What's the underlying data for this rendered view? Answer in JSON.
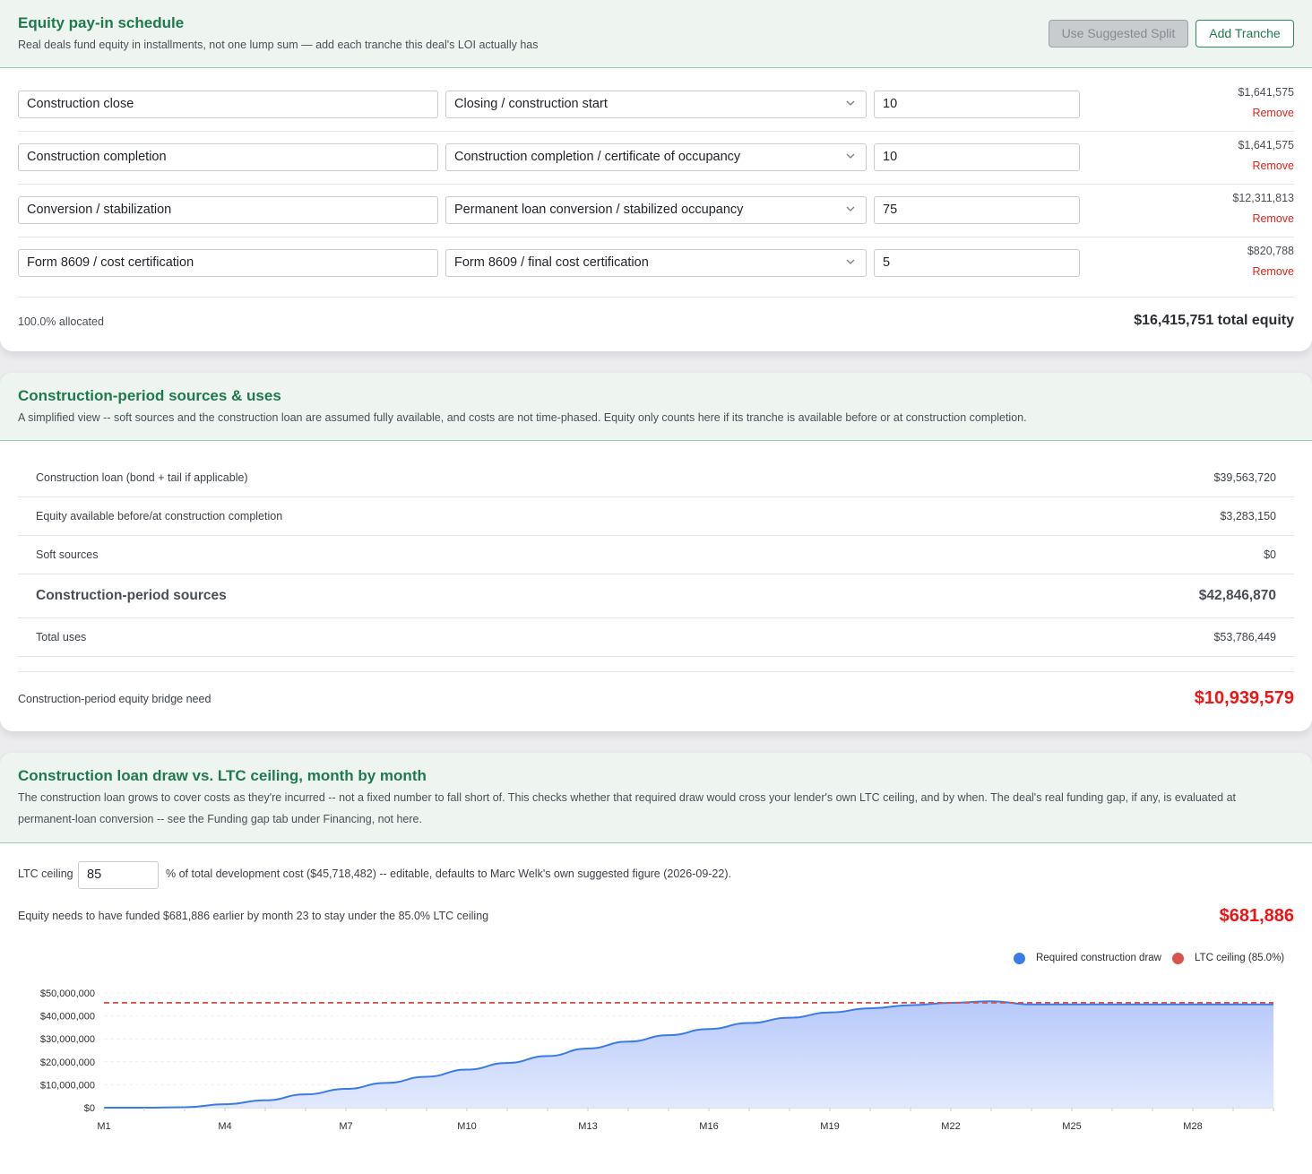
{
  "equity_schedule": {
    "title": "Equity pay-in schedule",
    "subtitle": "Real deals fund equity in installments, not one lump sum — add each tranche this deal's LOI actually has",
    "use_suggested_split_label": "Use Suggested Split",
    "add_tranche_label": "Add Tranche",
    "remove_label": "Remove",
    "tranches": [
      {
        "name": "Construction close",
        "milestone": "Closing / construction start",
        "percent": "10",
        "amount": "$1,641,575"
      },
      {
        "name": "Construction completion",
        "milestone": "Construction completion / certificate of occupancy",
        "percent": "10",
        "amount": "$1,641,575"
      },
      {
        "name": "Conversion / stabilization",
        "milestone": "Permanent loan conversion / stabilized occupancy",
        "percent": "75",
        "amount": "$12,311,813"
      },
      {
        "name": "Form 8609 / cost certification",
        "milestone": "Form 8609 / final cost certification",
        "percent": "5",
        "amount": "$820,788"
      }
    ],
    "allocated_text": "100.0% allocated",
    "total_equity_text": "$16,415,751 total equity"
  },
  "sources_uses": {
    "title": "Construction-period sources & uses",
    "subtitle": "A simplified view -- soft sources and the construction loan are assumed fully available, and costs are not time-phased. Equity only counts here if its tranche is available before or at construction completion.",
    "rows": [
      {
        "label": "Construction loan (bond + tail if applicable)",
        "value": "$39,563,720"
      },
      {
        "label": "Equity available before/at construction completion",
        "value": "$3,283,150"
      },
      {
        "label": "Soft sources",
        "value": "$0"
      }
    ],
    "total_sources_label": "Construction-period sources",
    "total_sources_value": "$42,846,870",
    "total_uses_label": "Total uses",
    "total_uses_value": "$53,786,449",
    "bridge_label": "Construction-period equity bridge need",
    "bridge_value": "$10,939,579"
  },
  "draw_chart": {
    "title": "Construction loan draw vs. LTC ceiling, month by month",
    "subtitle": "The construction loan grows to cover costs as they're incurred -- not a fixed number to fall short of. This checks whether that required draw would cross your lender's own LTC ceiling, and by when. The deal's real funding gap, if any, is evaluated at permanent-loan conversion -- see the Funding gap tab under Financing, not here.",
    "ltc_label": "LTC ceiling",
    "ltc_value": "85",
    "ltc_desc": "% of total development cost ($45,718,482) -- editable, defaults to Marc Welk's own suggested figure (2026-09-22).",
    "equity_needed_text": "Equity needs to have funded $681,886 earlier by month 23 to stay under the 85.0% LTC ceiling",
    "equity_needed_value": "$681,886",
    "colors": {
      "draw": "#3b7be8",
      "ceiling": "#d9534f",
      "fill": "#c3d2fb"
    }
  },
  "chart_data": {
    "type": "area",
    "x": [
      "M1",
      "M2",
      "M3",
      "M4",
      "M5",
      "M6",
      "M7",
      "M8",
      "M9",
      "M10",
      "M11",
      "M12",
      "M13",
      "M14",
      "M15",
      "M16",
      "M17",
      "M18",
      "M19",
      "M20",
      "M21",
      "M22",
      "M23",
      "M24",
      "M25",
      "M26",
      "M27",
      "M28",
      "M29",
      "M30"
    ],
    "x_tick_labels": [
      "M1",
      "M4",
      "M7",
      "M10",
      "M13",
      "M16",
      "M19",
      "M22",
      "M25",
      "M28"
    ],
    "y_tick_labels": [
      "$0",
      "$10,000,000",
      "$20,000,000",
      "$30,000,000",
      "$40,000,000",
      "$50,000,000"
    ],
    "ylim": [
      0,
      50000000
    ],
    "legend_position": "top-right",
    "series": [
      {
        "name": "Required construction draw",
        "values": [
          0,
          0,
          200000,
          1500000,
          3200000,
          5800000,
          8200000,
          10800000,
          13500000,
          16600000,
          19500000,
          22500000,
          25800000,
          28800000,
          31600000,
          34300000,
          36900000,
          39200000,
          41500000,
          43300000,
          44700000,
          45700000,
          46400000,
          45000000,
          45000000,
          45000000,
          45000000,
          45000000,
          45000000,
          45000000
        ]
      },
      {
        "name": "LTC ceiling (85.0%)",
        "values": [
          45718482,
          45718482,
          45718482,
          45718482,
          45718482,
          45718482,
          45718482,
          45718482,
          45718482,
          45718482,
          45718482,
          45718482,
          45718482,
          45718482,
          45718482,
          45718482,
          45718482,
          45718482,
          45718482,
          45718482,
          45718482,
          45718482,
          45718482,
          45718482,
          45718482,
          45718482,
          45718482,
          45718482,
          45718482,
          45718482
        ]
      }
    ]
  }
}
